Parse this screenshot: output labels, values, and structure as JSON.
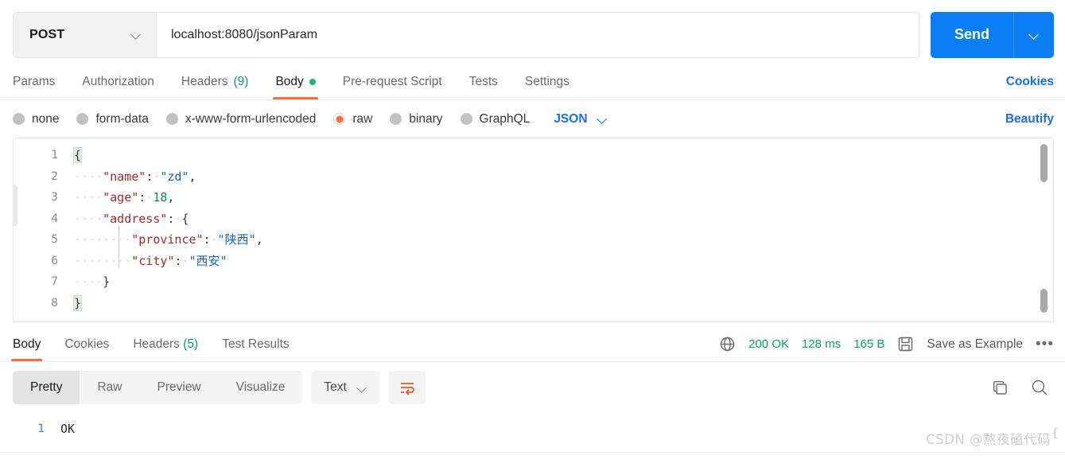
{
  "request": {
    "method": "POST",
    "url": "localhost:8080/jsonParam",
    "send_label": "Send",
    "tabs": [
      {
        "label": "Params",
        "active": false
      },
      {
        "label": "Authorization",
        "active": false
      },
      {
        "label": "Headers",
        "count": "(9)",
        "active": false
      },
      {
        "label": "Body",
        "active": true,
        "dot": true
      },
      {
        "label": "Pre-request Script",
        "active": false
      },
      {
        "label": "Tests",
        "active": false
      },
      {
        "label": "Settings",
        "active": false
      }
    ],
    "cookies_link": "Cookies"
  },
  "body_options": {
    "radios": [
      {
        "label": "none",
        "selected": false
      },
      {
        "label": "form-data",
        "selected": false
      },
      {
        "label": "x-www-form-urlencoded",
        "selected": false
      },
      {
        "label": "raw",
        "selected": true
      },
      {
        "label": "binary",
        "selected": false
      },
      {
        "label": "GraphQL",
        "selected": false
      }
    ],
    "language": "JSON",
    "beautify_label": "Beautify"
  },
  "editor": {
    "lines": [
      {
        "num": "1",
        "segments": [
          {
            "t": "{",
            "c": "p br-hl"
          }
        ]
      },
      {
        "num": "2",
        "segments": [
          {
            "t": "····",
            "c": "ws"
          },
          {
            "t": "\"name\"",
            "c": "k"
          },
          {
            "t": ":",
            "c": "p"
          },
          {
            "t": "·",
            "c": "ws"
          },
          {
            "t": "\"zd\"",
            "c": "s"
          },
          {
            "t": ",",
            "c": "p"
          }
        ]
      },
      {
        "num": "3",
        "segments": [
          {
            "t": "····",
            "c": "ws"
          },
          {
            "t": "\"age\"",
            "c": "k"
          },
          {
            "t": ":",
            "c": "p"
          },
          {
            "t": "·",
            "c": "ws"
          },
          {
            "t": "18",
            "c": "n"
          },
          {
            "t": ",",
            "c": "p"
          }
        ]
      },
      {
        "num": "4",
        "segments": [
          {
            "t": "····",
            "c": "ws"
          },
          {
            "t": "\"address\"",
            "c": "k"
          },
          {
            "t": ":",
            "c": "p"
          },
          {
            "t": "·",
            "c": "ws"
          },
          {
            "t": "{",
            "c": "p"
          }
        ]
      },
      {
        "num": "5",
        "segments": [
          {
            "t": "····",
            "c": "ws"
          },
          {
            "t": "····",
            "c": "ws"
          },
          {
            "t": "\"province\"",
            "c": "k"
          },
          {
            "t": ":",
            "c": "p"
          },
          {
            "t": "·",
            "c": "ws"
          },
          {
            "t": "\"陕西\"",
            "c": "s"
          },
          {
            "t": ",",
            "c": "p"
          }
        ]
      },
      {
        "num": "6",
        "segments": [
          {
            "t": "····",
            "c": "ws"
          },
          {
            "t": "····",
            "c": "ws"
          },
          {
            "t": "\"city\"",
            "c": "k"
          },
          {
            "t": ":",
            "c": "p"
          },
          {
            "t": "·",
            "c": "ws"
          },
          {
            "t": "\"西安\"",
            "c": "s"
          }
        ]
      },
      {
        "num": "7",
        "segments": [
          {
            "t": "····",
            "c": "ws"
          },
          {
            "t": "}",
            "c": "p"
          }
        ]
      },
      {
        "num": "8",
        "segments": [
          {
            "t": "}",
            "c": "p br-hl"
          }
        ]
      }
    ]
  },
  "response": {
    "tabs": [
      {
        "label": "Body",
        "active": true
      },
      {
        "label": "Cookies",
        "active": false
      },
      {
        "label": "Headers",
        "count": "(5)",
        "active": false
      },
      {
        "label": "Test Results",
        "active": false
      }
    ],
    "status": "200 OK",
    "time": "128 ms",
    "size": "165 B",
    "save_label": "Save as Example",
    "more_label": "•••",
    "view_modes": [
      {
        "label": "Pretty",
        "active": true
      },
      {
        "label": "Raw",
        "active": false
      },
      {
        "label": "Preview",
        "active": false
      },
      {
        "label": "Visualize",
        "active": false
      }
    ],
    "format": "Text",
    "lines": [
      {
        "num": "1",
        "text": "OK"
      }
    ]
  },
  "watermark": {
    "text": "CSDN @熬夜磕代码"
  },
  "colors": {
    "accent_orange": "#ff6c37",
    "link_blue": "#1a6ef0",
    "send_blue": "#0b7ef5",
    "status_green": "#0e9f6e",
    "json_key": "#a52a2a",
    "json_string": "#1a65b8",
    "json_number": "#0b8a55"
  }
}
